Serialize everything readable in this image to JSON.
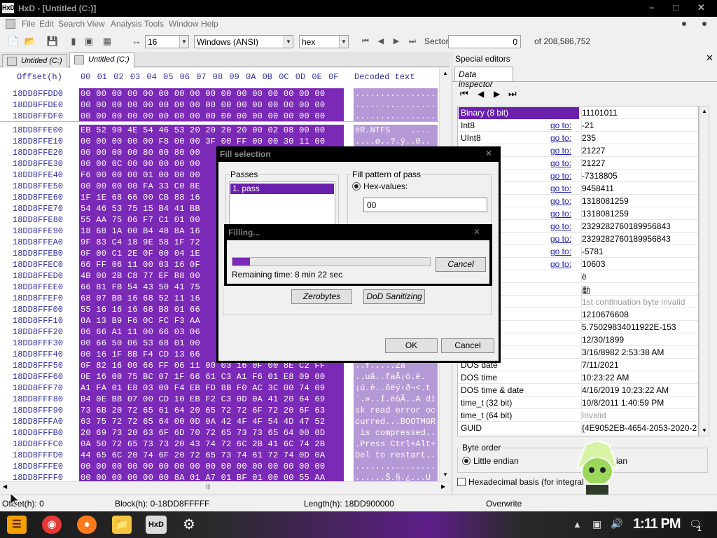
{
  "window": {
    "title": "HxD - [Untitled (C:)]",
    "app_icon_text": "HxD"
  },
  "menu": [
    "File",
    "Edit",
    "Search",
    "View",
    "Analysis",
    "Tools",
    "Window",
    "Help"
  ],
  "toolbar": {
    "bytes_per_row": "16",
    "charset": "Windows (ANSI)",
    "display_mode": "hex",
    "sector_label": "Sector",
    "sector_value": "0",
    "sector_total": "of 208,586,752"
  },
  "tabs": [
    {
      "label": "Untitled (C:)"
    },
    {
      "label": "Untitled (C:)"
    }
  ],
  "hex": {
    "header_offset": "Offset(h)",
    "columns": [
      "00",
      "01",
      "02",
      "03",
      "04",
      "05",
      "06",
      "07",
      "08",
      "09",
      "0A",
      "0B",
      "0C",
      "0D",
      "0E",
      "0F"
    ],
    "header_decoded": "Decoded text",
    "rows": [
      {
        "offset": "18DD8FFDD0",
        "bytes": "00 00 00 00 00 00 00 00 00 00 00 00 00 00 00 00",
        "text": "................"
      },
      {
        "offset": "18DD8FFDE0",
        "bytes": "00 00 00 00 00 00 00 00 00 00 00 00 00 00 00 00",
        "text": "................"
      },
      {
        "offset": "18DD8FFDF0",
        "bytes": "00 00 00 00 00 00 00 00 00 00 00 00 00 00 00 00",
        "text": "................"
      },
      {
        "offset": "18DD8FFE00",
        "bytes": "EB 52 90 4E 54 46 53 20 20 20 20 00 02 08 00 00",
        "text": "ëR.NTFS    ...."
      },
      {
        "offset": "18DD8FFE10",
        "bytes": "00 00 00 00 00 F8 00 00 3F 00 FF 00 00 30 11 00",
        "text": "....ø..?.ÿ..0.."
      },
      {
        "offset": "18DD8FFE20",
        "bytes": "00 00 00 00 80 00 80 00",
        "text": ""
      },
      {
        "offset": "18DD8FFE30",
        "bytes": "00 00 0C 00 00 00 00 00",
        "text": ""
      },
      {
        "offset": "18DD8FFE40",
        "bytes": "F6 00 00 00 01 00 00 00",
        "text": ""
      },
      {
        "offset": "18DD8FFE50",
        "bytes": "00 00 00 00 FA 33 C0 8E",
        "text": ""
      },
      {
        "offset": "18DD8FFE60",
        "bytes": "1F 1E 68 66 00 CB 88 16",
        "text": ""
      },
      {
        "offset": "18DD8FFE70",
        "bytes": "54 46 53 75 15 B4 41 BB",
        "text": ""
      },
      {
        "offset": "18DD8FFE80",
        "bytes": "55 AA 75 06 F7 C1 01 00",
        "text": ""
      },
      {
        "offset": "18DD8FFE90",
        "bytes": "18 68 1A 00 B4 48 8A 16",
        "text": ""
      },
      {
        "offset": "18DD8FFEA0",
        "bytes": "9F 83 C4 18 9E 58 1F 72",
        "text": ""
      },
      {
        "offset": "18DD8FFEB0",
        "bytes": "0F 00 C1 2E 0F 00 04 1E",
        "text": ""
      },
      {
        "offset": "18DD8FFEC0",
        "bytes": "66 FF 06 11 00 03 16 0F",
        "text": ""
      },
      {
        "offset": "18DD8FFED0",
        "bytes": "4B 00 2B C8 77 EF B8 00",
        "text": ""
      },
      {
        "offset": "18DD8FFEE0",
        "bytes": "66 81 FB 54 43 50 41 75",
        "text": ""
      },
      {
        "offset": "18DD8FFEF0",
        "bytes": "68 07 BB 16 68 52 11 16",
        "text": ""
      },
      {
        "offset": "18DD8FFF00",
        "bytes": "55 16 16 16 68 B8 01 66",
        "text": ""
      },
      {
        "offset": "18DD8FFF10",
        "bytes": "0A 13 B9 F6 0C FC F3 AA",
        "text": ""
      },
      {
        "offset": "18DD8FFF20",
        "bytes": "06 66 A1 11 00 66 03 06",
        "text": ""
      },
      {
        "offset": "18DD8FFF30",
        "bytes": "00 66 50 06 53 68 01 00",
        "text": ""
      },
      {
        "offset": "18DD8FFF40",
        "bytes": "00 16 1F 8B F4 CD 13 66",
        "text": ""
      },
      {
        "offset": "18DD8FFF50",
        "bytes": "0F 82 16 00 66 FF 06 11 00 03 16 0F 00 8E C2 FF",
        "text": "..f.....Za"
      },
      {
        "offset": "18DD8FFF60",
        "bytes": "0E 16 00 75 BC 07 1F 66 61 C3 A1 F6 01 E8 09 00",
        "text": "..uå..faÃ¡ö.è."
      },
      {
        "offset": "18DD8FFF70",
        "bytes": "A1 FA 01 E8 03 00 F4 EB FD 8B F0 AC 3C 00 74 09",
        "text": "¡ú.è..ôëý‹ð¬<.t"
      },
      {
        "offset": "18DD8FFF80",
        "bytes": "B4 0E BB 07 00 CD 10 EB F2 C3 0D 0A 41 20 64 69",
        "text": "´.»..Í.ëòÃ..A di"
      },
      {
        "offset": "18DD8FFF90",
        "bytes": "73 6B 20 72 65 61 64 20 65 72 72 6F 72 20 6F 63",
        "text": "sk read error oc"
      },
      {
        "offset": "18DD8FFFA0",
        "bytes": "63 75 72 72 65 64 00 0D 0A 42 4F 4F 54 4D 47 52",
        "text": "curred...BOOTMGR"
      },
      {
        "offset": "18DD8FFFB0",
        "bytes": "20 69 73 20 63 6F 6D 70 72 65 73 73 65 64 00 0D",
        "text": " is compressed.."
      },
      {
        "offset": "18DD8FFFC0",
        "bytes": "0A 50 72 65 73 73 20 43 74 72 6C 2B 41 6C 74 2B",
        "text": ".Press Ctrl+Alt+"
      },
      {
        "offset": "18DD8FFFD0",
        "bytes": "44 65 6C 20 74 6F 20 72 65 73 74 61 72 74 0D 0A",
        "text": "Del to restart.."
      },
      {
        "offset": "18DD8FFFE0",
        "bytes": "00 00 00 00 00 00 00 00 00 00 00 00 00 00 00 00",
        "text": "................"
      },
      {
        "offset": "18DD8FFFF0",
        "bytes": "00 00 00 00 00 00 8A 01 A7 01 BF 01 00 00 55 AA",
        "text": "......Š.§.¿...U"
      }
    ]
  },
  "statusbar": {
    "offset": "Offset(h): 0",
    "block": "Block(h): 0-18DD8FFFFF",
    "length": "Length(h): 18DD900000",
    "mode": "Overwrite"
  },
  "special_editors": {
    "title": "Special editors",
    "tab": "Data inspector",
    "goto": "go to:",
    "rows": [
      {
        "label": "Binary (8 bit)",
        "value": "11101011",
        "goto": false,
        "selected": true
      },
      {
        "label": "Int8",
        "value": "-21",
        "goto": true
      },
      {
        "label": "UInt8",
        "value": "235",
        "goto": true
      },
      {
        "label": "",
        "value": "21227",
        "goto": true
      },
      {
        "label": "",
        "value": "21227",
        "goto": true
      },
      {
        "label": "",
        "value": "-7318805",
        "goto": true
      },
      {
        "label": "",
        "value": "9458411",
        "goto": true
      },
      {
        "label": "",
        "value": "1318081259",
        "goto": true
      },
      {
        "label": "",
        "value": "1318081259",
        "goto": true
      },
      {
        "label": "",
        "value": "2329282760189956843",
        "goto": true
      },
      {
        "label": "",
        "value": "2329282760189956843",
        "goto": true
      },
      {
        "label": "",
        "value": "-5781",
        "goto": true
      },
      {
        "label": "",
        "value": "10603",
        "goto": true
      },
      {
        "label": "char8_t",
        "value": "ë",
        "goto": false
      },
      {
        "label": "char16_t",
        "value": "勫",
        "goto": false
      },
      {
        "label": "point",
        "value": "1st continuation byte invalid",
        "goto": false,
        "muted": true
      },
      {
        "label": "32)",
        "value": "1210676608",
        "goto": false
      },
      {
        "label": "t64)",
        "value": "5.75029834011922E-153",
        "goto": false
      },
      {
        "label": "",
        "value": "12/30/1899",
        "goto": false
      },
      {
        "label": "",
        "value": "3/16/8982 2:53:38 AM",
        "goto": false
      },
      {
        "label": "DOS date",
        "value": "7/11/2021",
        "goto": false
      },
      {
        "label": "DOS time",
        "value": "10:23:22 AM",
        "goto": false
      },
      {
        "label": "DOS time & date",
        "value": "4/16/2019 10:23:22 AM",
        "goto": false
      },
      {
        "label": "time_t (32 bit)",
        "value": "10/8/2011 1:40:59 PM",
        "goto": false
      },
      {
        "label": "time_t (64 bit)",
        "value": "Invalid",
        "goto": false,
        "muted": true
      },
      {
        "label": "GUID",
        "value": "{4E9052EB-4654-2053-2020-2000",
        "goto": false
      }
    ],
    "byte_order_label": "Byte order",
    "little_endian": "Little endian",
    "big_endian_partial": "ian",
    "hex_basis": "Hexadecimal basis (for integral nu"
  },
  "fill_dialog": {
    "title": "Fill selection",
    "passes_label": "Passes",
    "pass_item": "1. pass",
    "pattern_label": "Fill pattern of pass",
    "hex_values_label": "Hex-values:",
    "hex_value": "00",
    "zerobytes": "Zerobytes",
    "dod": "DoD Sanitizing",
    "ok": "OK",
    "cancel": "Cancel"
  },
  "progress_dialog": {
    "title": "Filling...",
    "remaining": "Remaining time: 8 min 22 sec",
    "cancel": "Cancel",
    "progress": 0.09
  },
  "taskbar": {
    "clock": "1:11 PM",
    "notification_count": "1"
  },
  "colors": {
    "selection": "#7b2ab7",
    "decoded_selection": "#b598d6",
    "inspector_selected": "#6b1fad"
  }
}
